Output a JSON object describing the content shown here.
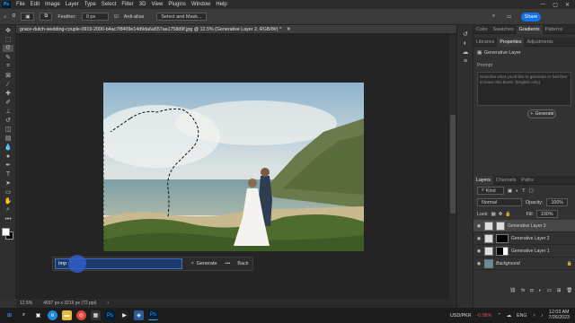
{
  "menubar": {
    "app_logo": "Ps",
    "items": [
      "File",
      "Edit",
      "Image",
      "Layer",
      "Type",
      "Select",
      "Filter",
      "3D",
      "View",
      "Plugins",
      "Window",
      "Help"
    ],
    "share_label": "Share"
  },
  "options": {
    "feather_label": "Feather:",
    "feather_value": "0 px",
    "antialias_label": "Anti-alias",
    "select_mask_label": "Select and Mask..."
  },
  "document": {
    "tab_title": "grace-dutch-wedding-couple-0919-2000-b4ac7f8409e14d9da6a557aa1758d9f.jpg @ 12.5% (Generative Layer 2, RGB/8#) *",
    "zoom": "12.5%",
    "dimensions": "4937 px x 3216 px (72 ppi)"
  },
  "contextual_bar": {
    "prompt_value": "Imp",
    "generate_label": "Generate",
    "more_label": "•••",
    "back_label": "Back"
  },
  "right_panel": {
    "top_tabs": [
      "Color",
      "Swatches",
      "Gradients",
      "Patterns"
    ],
    "top_active": "Gradients",
    "mid_tabs": [
      "Libraries",
      "Properties",
      "Adjustments"
    ],
    "mid_active": "Properties",
    "layer_type_label": "Generative Layer",
    "prompt_label": "Prompt",
    "prompt_placeholder": "Describe what you'd like to generate or feel free to leave this blank. (English only)",
    "generate_label": "Generate",
    "layers_tabs": [
      "Layers",
      "Channels",
      "Paths"
    ],
    "layers_active": "Layers",
    "filter_kind": "Kind",
    "blend_mode": "Normal",
    "opacity_label": "Opacity:",
    "opacity_value": "100%",
    "lock_label": "Lock:",
    "fill_label": "Fill:",
    "fill_value": "100%",
    "layers": [
      {
        "name": "Generative Layer 3"
      },
      {
        "name": "Generative Layer 2"
      },
      {
        "name": "Generative Layer 1"
      },
      {
        "name": "Background"
      }
    ]
  },
  "taskbar": {
    "stock_symbol": "USD/PKR",
    "stock_change": "-0.98%",
    "language": "ENG",
    "time": "12:03 AM",
    "date": "7/26/2023"
  },
  "colors": {
    "accent_blue": "#1473e6",
    "stock_red": "#e05050"
  }
}
